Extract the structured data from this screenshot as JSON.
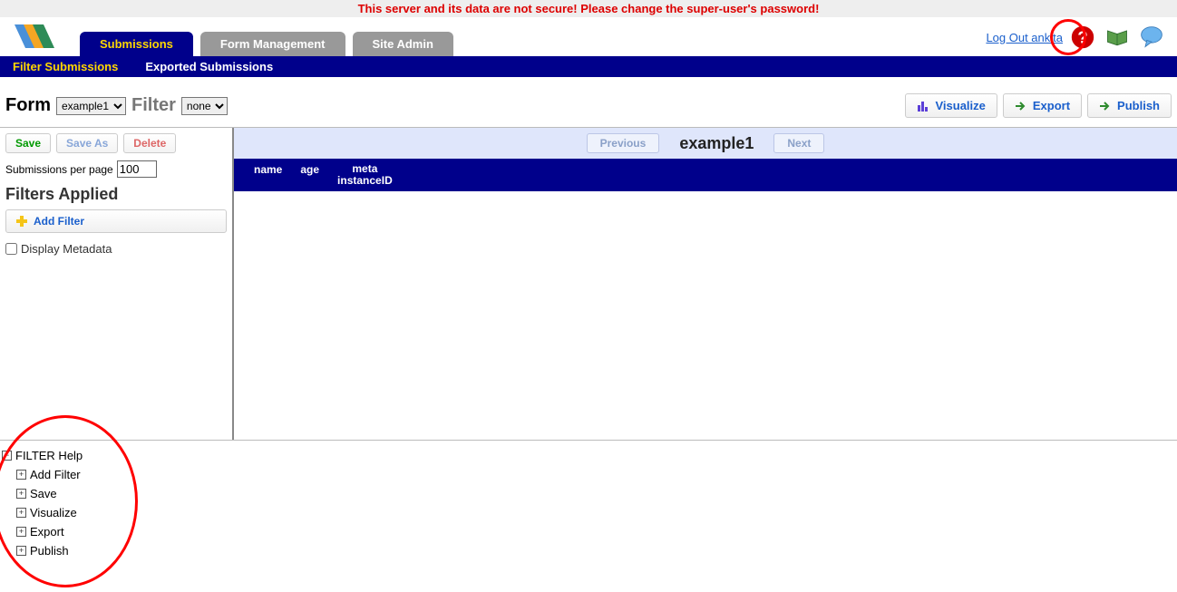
{
  "warning": "This server and its data are not secure! Please change the super-user's password!",
  "tabs": {
    "submissions": "Submissions",
    "form_mgmt": "Form Management",
    "site_admin": "Site Admin"
  },
  "logout": "Log Out ankita",
  "subnav": {
    "filter": "Filter Submissions",
    "exported": "Exported Submissions"
  },
  "toolbar": {
    "form_label": "Form",
    "form_select": "example1",
    "filter_label": "Filter",
    "filter_select": "none",
    "visualize": "Visualize",
    "export": "Export",
    "publish": "Publish"
  },
  "side": {
    "save": "Save",
    "save_as": "Save As",
    "delete": "Delete",
    "sub_per_page_label": "Submissions per page",
    "sub_per_page_value": "100",
    "filters_applied": "Filters Applied",
    "add_filter": "Add Filter",
    "display_metadata": "Display Metadata"
  },
  "pager": {
    "previous": "Previous",
    "title": "example1",
    "next": "Next"
  },
  "columns": {
    "name": "name",
    "age": "age",
    "meta1": "meta",
    "meta2": "instanceID"
  },
  "help": {
    "root": "FILTER Help",
    "items": [
      "Add Filter",
      "Save",
      "Visualize",
      "Export",
      "Publish"
    ]
  }
}
